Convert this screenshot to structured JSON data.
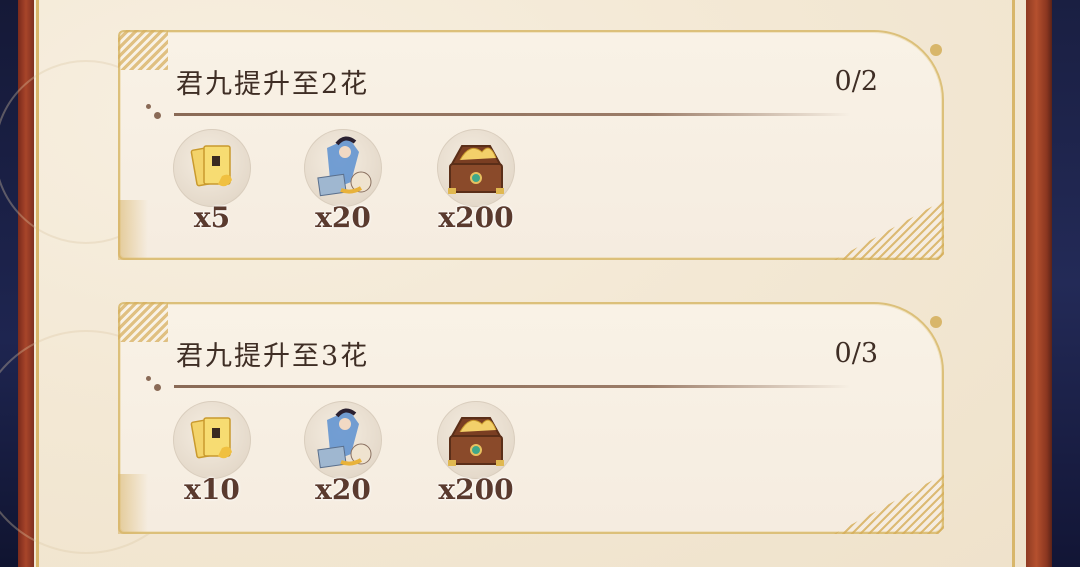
{
  "tasks": [
    {
      "title": "君九提升至2花",
      "progress": "0/2",
      "rewards": [
        {
          "icon": "golden-scroll-icon",
          "qty": "x5"
        },
        {
          "icon": "hero-figure-icon",
          "qty": "x20"
        },
        {
          "icon": "treasure-chest-icon",
          "qty": "x200"
        }
      ]
    },
    {
      "title": "君九提升至3花",
      "progress": "0/3",
      "rewards": [
        {
          "icon": "golden-scroll-icon",
          "qty": "x10"
        },
        {
          "icon": "hero-figure-icon",
          "qty": "x20"
        },
        {
          "icon": "treasure-chest-icon",
          "qty": "x200"
        }
      ]
    }
  ],
  "colors": {
    "text": "#3f2e25",
    "gold": "#d8b66a",
    "frame_red": "#a8452a",
    "parchment": "#f5ece0"
  }
}
